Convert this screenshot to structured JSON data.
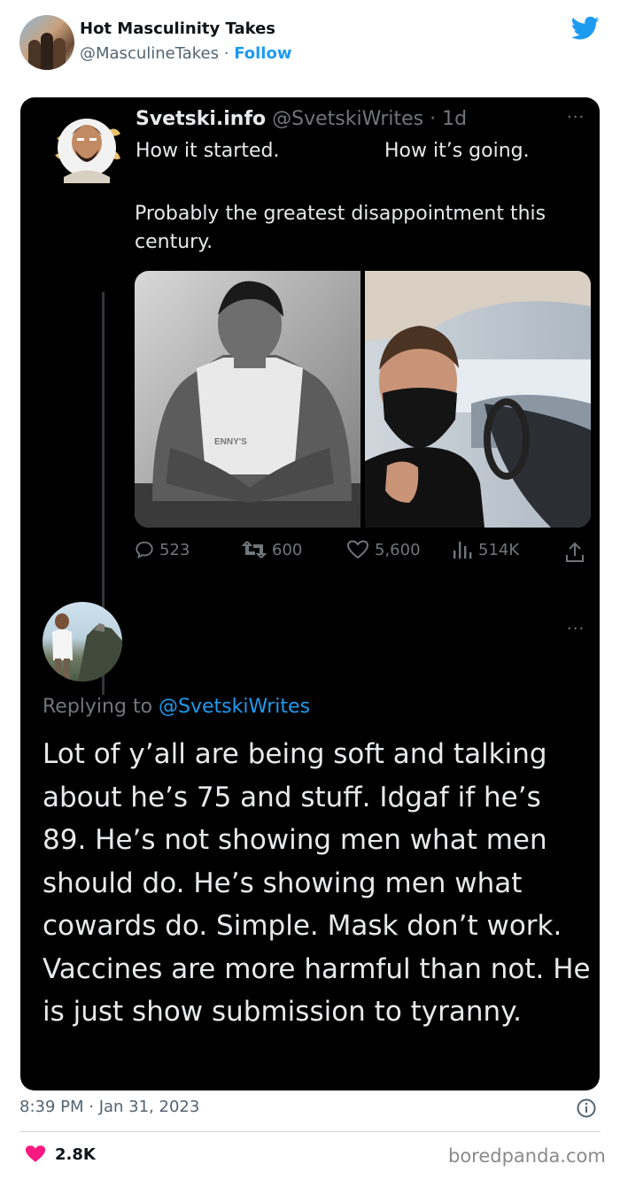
{
  "outer": {
    "name": "Hot Masculinity Takes",
    "handle": "@MasculineTakes",
    "separator": " · ",
    "follow": "Follow",
    "time": "8:39 PM · Jan 31, 2023",
    "likes": "2.8K",
    "accent": "#1d9bf0"
  },
  "quoted": {
    "name": "Svetski.info",
    "handle": "@SvetskiWrites",
    "age": " · 1d",
    "more": "···",
    "started": "How it started.",
    "going": "How it’s going.",
    "text": "Probably the greatest disappointment this century.",
    "replies": "523",
    "retweets": "600",
    "likes": "5,600",
    "views": "514K"
  },
  "reply": {
    "more": "···",
    "replying_prefix": "Replying to ",
    "replying_to": "@SvetskiWrites",
    "text": "Lot of y’all are being soft and talking about he’s 75 and stuff. Idgaf if he’s 89. He’s not showing men what men should do. He’s showing men what cowards do. Simple. Mask don’t work. Vaccines are more harmful than not. He is just show submission to tyranny."
  },
  "watermark": "boredpanda.com",
  "icons": [
    "twitter-bird-icon",
    "reply-icon",
    "retweet-icon",
    "heart-icon",
    "views-icon",
    "share-icon",
    "info-icon"
  ]
}
